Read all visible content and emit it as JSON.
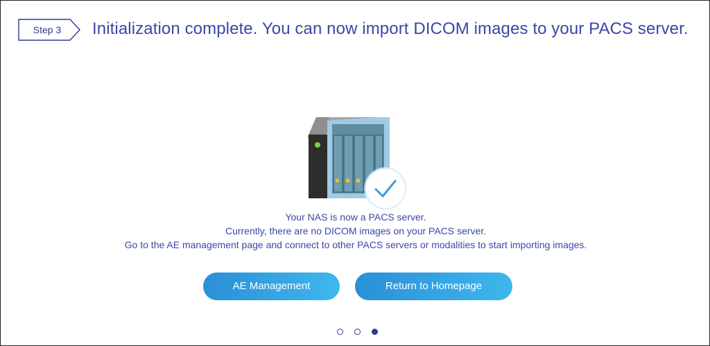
{
  "header": {
    "step_label": "Step 3",
    "title": "Initialization complete. You can now import DICOM images to your PACS server."
  },
  "illustration": {
    "icon": "nas-server-with-checkmark-icon",
    "check_color": "#3a9fdc"
  },
  "messages": {
    "line1": "Your NAS is now a PACS server.",
    "line2": "Currently, there are no DICOM images on your PACS server.",
    "line3": "Go to the AE management page and connect to other PACS servers or modalities to start importing images."
  },
  "buttons": {
    "ae_management": "AE Management",
    "return_home": "Return to Homepage"
  },
  "pager": {
    "total": 3,
    "active_index": 3
  },
  "colors": {
    "accent_text": "#3b46a8",
    "button_gradient_start": "#2a8fd6",
    "button_gradient_end": "#3fb7ee"
  }
}
